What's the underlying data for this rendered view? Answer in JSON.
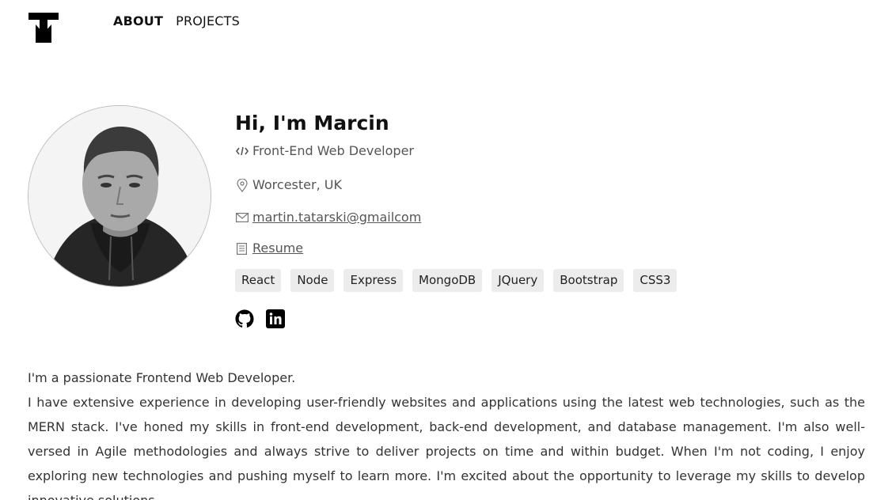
{
  "nav": {
    "logo_icon": "tm-logo-icon",
    "items": [
      {
        "label": "ABOUT",
        "active": true
      },
      {
        "label": "PROJECTS",
        "active": false
      }
    ]
  },
  "profile": {
    "avatar_icon": "profile-photo",
    "greeting": "Hi, I'm Marcin",
    "role_icon": "code-icon",
    "role": "Front-End Web Developer",
    "location_icon": "map-pin-icon",
    "location": "Worcester, UK",
    "email_icon": "envelope-icon",
    "email": "martin.tatarski@gmailcom",
    "resume_icon": "document-icon",
    "resume": "Resume"
  },
  "skills": [
    "React",
    "Node",
    "Express",
    "MongoDB",
    "JQuery",
    "Bootstrap",
    "CSS3"
  ],
  "socials": {
    "github_icon": "github-icon",
    "linkedin_icon": "linkedin-icon"
  },
  "bio": {
    "line1": "I'm a passionate Frontend Web Developer.",
    "line2": "I have extensive experience in developing user-friendly websites and applications using the latest web technologies, such as the MERN stack. I've honed my skills in front-end development, back-end development, and database management. I'm also well-versed in Agile methodologies and always strive to deliver projects on time and within budget. When I'm not coding, I enjoy exploring new technologies and pushing myself to learn more. I'm excited about the opportunity to leverage my skills to develop innovative solutions."
  },
  "colors": {
    "text": "#111111",
    "muted": "#555555",
    "tag_bg": "#ececec"
  }
}
